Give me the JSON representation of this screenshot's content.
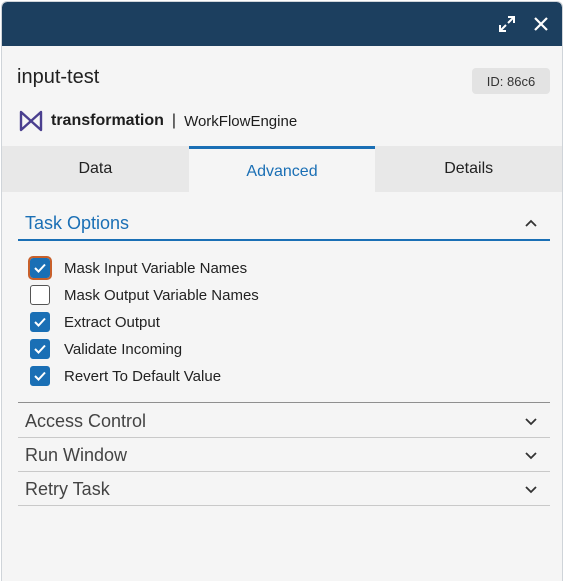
{
  "window": {
    "expand_icon": "expand-icon",
    "close_icon": "close-icon"
  },
  "task": {
    "name": "input-test",
    "id_label": "ID: 86c6"
  },
  "brand": {
    "app": "transformation",
    "separator": "|",
    "adapter": "WorkFlowEngine",
    "logo_icon": "bowtie-logo-icon"
  },
  "tabs": [
    {
      "label": "Data",
      "active": false
    },
    {
      "label": "Advanced",
      "active": true
    },
    {
      "label": "Details",
      "active": false
    }
  ],
  "task_options": {
    "title": "Task Options",
    "options": [
      {
        "label": "Mask Input Variable Names",
        "checked": true,
        "focused": true
      },
      {
        "label": "Mask Output Variable Names",
        "checked": false
      },
      {
        "label": "Extract Output",
        "checked": true
      },
      {
        "label": "Validate Incoming",
        "checked": true
      },
      {
        "label": "Revert To Default Value",
        "checked": true
      }
    ]
  },
  "sections": [
    {
      "title": "Access Control"
    },
    {
      "title": "Run Window"
    },
    {
      "title": "Retry Task"
    }
  ],
  "colors": {
    "titlebar": "#1c3f5f",
    "accent": "#1a6fb5",
    "focus": "#c8602b"
  }
}
